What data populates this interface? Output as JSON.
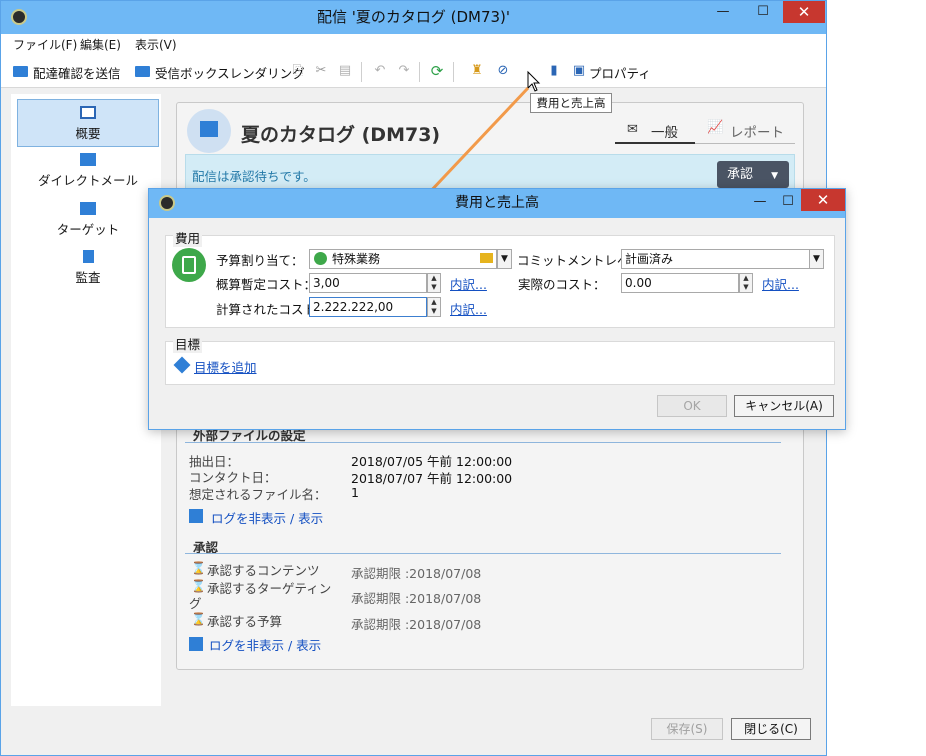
{
  "window": {
    "title": "配信 '夏のカタログ (DM73)'",
    "controls": {
      "minimize": "—",
      "maximize": "☐",
      "close": "✕"
    }
  },
  "menubar": {
    "items": [
      "ファイル(F)",
      "編集(E)",
      "表示(V)"
    ]
  },
  "toolbar": {
    "send_proof": "配達確認を送信",
    "inbox_rendering": "受信ボックスレンダリング",
    "properties": "プロパティ"
  },
  "tooltip": "費用と売上高",
  "leftnav": {
    "items": [
      {
        "label": "概要",
        "icon": "overview-icon",
        "selected": true
      },
      {
        "label": "ダイレクトメール",
        "icon": "direct-mail-icon"
      },
      {
        "label": "ターゲット",
        "icon": "target-icon"
      },
      {
        "label": "監査",
        "icon": "audit-icon"
      }
    ]
  },
  "content": {
    "title": "夏のカタログ (DM73)",
    "tabs": {
      "general": "一般",
      "report": "レポート"
    },
    "banner_text": "配信は承認待ちです。",
    "approve_button": "承認",
    "external_file": {
      "heading": "外部ファイルの設定",
      "rows": [
        {
          "label": "抽出日：",
          "value": "2018/07/05 午前 12:00:00"
        },
        {
          "label": "コンタクト日：",
          "value": "2018/07/07 午前 12:00:00"
        },
        {
          "label": "想定されるファイル名：",
          "value": "1"
        }
      ],
      "log_link": "ログを非表示 / 表示"
    },
    "approval": {
      "heading": "承認",
      "rows": [
        {
          "label": "承認するコンテンツ",
          "value": "承認期限 :2018/07/08"
        },
        {
          "label": "承認するターゲティン",
          "label2": "グ",
          "value": "承認期限 :2018/07/08"
        },
        {
          "label": "承認する予算",
          "value": "承認期限 :2018/07/08"
        }
      ],
      "log_link": "ログを非表示 / 表示"
    }
  },
  "footer": {
    "save": "保存(S)",
    "close": "閉じる(C)"
  },
  "dialog": {
    "title": "費用と売上高",
    "costs_group": "費用",
    "budget_label": "予算割り当て：",
    "budget_value": "特殊業務",
    "commitment_label": "コミットメントレベル：",
    "commitment_value": "計画済み",
    "estimated_label": "概算暫定コスト：",
    "estimated_value": "3,00",
    "actual_label": "実際のコスト：",
    "actual_value": "0.00",
    "calculated_label": "計算されたコスト：",
    "calculated_value": "2.222.222,00",
    "details_link": "内訳...",
    "objectives_group": "目標",
    "add_objective": "目標を追加",
    "ok": "OK",
    "cancel": "キャンセル(A)"
  },
  "colors": {
    "titlebar": "#6fb8f5",
    "accent_green": "#3ea84a",
    "link_blue": "#1450c2",
    "arrow_orange": "#f29a4a"
  }
}
